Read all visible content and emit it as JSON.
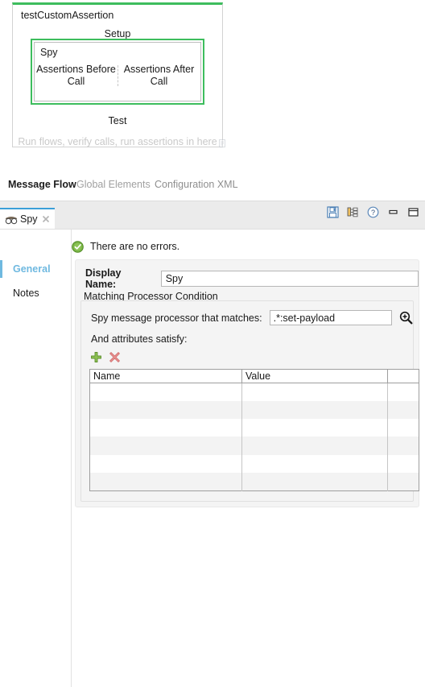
{
  "canvas": {
    "flow_title": "testCustomAssertion",
    "setup_label": "Setup",
    "test_label": "Test",
    "hint_text": "Run flows, verify calls, run assertions in here",
    "spy": {
      "name": "Spy",
      "left_column": "Assertions Before Call",
      "right_column": "Assertions After Call"
    },
    "border_color": "#3dbd5d",
    "doc_icon": "document-icon"
  },
  "editor_tabs": [
    {
      "label": "Message Flow",
      "active": true
    },
    {
      "label": "Global Elements",
      "active": false
    },
    {
      "label": "Configuration XML",
      "active": false
    }
  ],
  "properties": {
    "tab": {
      "label": "Spy",
      "icon": "spy-icon",
      "close_icon": "close-icon",
      "accent_color": "#3b9fd8"
    },
    "toolbar": [
      {
        "name": "save-icon",
        "title": "Save"
      },
      {
        "name": "hierarchy-icon",
        "title": "Show Hierarchy"
      },
      {
        "name": "help-icon",
        "title": "Help"
      },
      {
        "name": "minimize-icon",
        "title": "Minimize"
      },
      {
        "name": "maximize-icon",
        "title": "Maximize"
      }
    ],
    "nav": [
      {
        "label": "General",
        "selected": true
      },
      {
        "label": "Notes",
        "selected": false
      }
    ],
    "status": {
      "text": "There are no errors.",
      "icon": "success-check-icon",
      "color": "#5aa72b"
    },
    "display_name": {
      "label": "Display Name:",
      "value": "Spy",
      "placeholder": ""
    },
    "matching_group": {
      "legend": "Matching Processor Condition",
      "matcher_label": "Spy message processor that matches:",
      "matcher_value": ".*:set-payload",
      "matcher_placeholder": "",
      "search_icon": "magnifier-zoom-in-icon",
      "attributes_label": "And attributes satisfy:",
      "add_button": {
        "name": "add-row-button",
        "icon": "plus-icon",
        "color": "#7cb342"
      },
      "remove_button": {
        "name": "remove-row-button",
        "icon": "cross-icon",
        "color": "#e08585"
      },
      "table": {
        "columns": [
          "Name",
          "Value",
          ""
        ],
        "rows": [
          [
            "",
            "",
            ""
          ],
          [
            "",
            "",
            ""
          ],
          [
            "",
            "",
            ""
          ],
          [
            "",
            "",
            ""
          ],
          [
            "",
            "",
            ""
          ],
          [
            "",
            "",
            ""
          ]
        ]
      }
    }
  }
}
